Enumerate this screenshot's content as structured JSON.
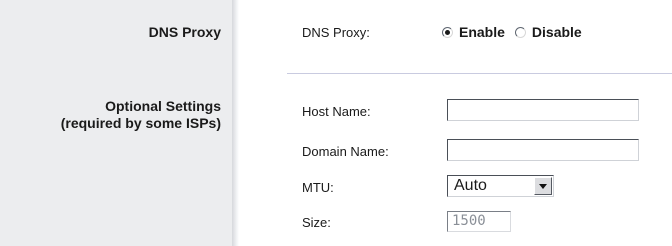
{
  "sections": {
    "dns_proxy": {
      "title": "DNS Proxy",
      "label": "DNS Proxy:",
      "options": {
        "enable": "Enable",
        "disable": "Disable"
      },
      "selected": "Enable"
    },
    "optional": {
      "title_line1": "Optional Settings",
      "title_line2": "(required by some ISPs)",
      "host_name": {
        "label": "Host Name:",
        "value": ""
      },
      "domain_name": {
        "label": "Domain Name:",
        "value": ""
      },
      "mtu": {
        "label": "MTU:",
        "selected": "Auto"
      },
      "size": {
        "label": "Size:",
        "value": "1500"
      }
    }
  },
  "icons": {
    "dropdown": "chevron-down-icon"
  }
}
